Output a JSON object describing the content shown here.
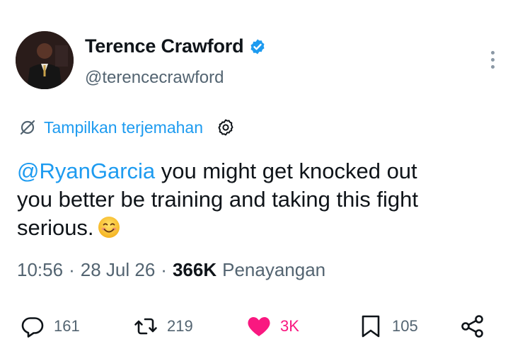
{
  "author": {
    "display_name": "Terence Crawford",
    "handle": "@terencecrawford",
    "verified": true,
    "verified_color": "#1d9bf0"
  },
  "translate": {
    "label": "Tampilkan terjemahan",
    "icon": "no-translate-icon",
    "settings_icon": "gear-icon"
  },
  "tweet": {
    "mention": "@RyanGarcia",
    "text_line1": " you might get knocked out",
    "text_line2": "you better be training and taking this fight",
    "text_line3": "serious.",
    "emoji": "smiling-face-emoji"
  },
  "meta": {
    "time": "10:56",
    "date": "28 Jul 26",
    "views_count": "366K",
    "views_label": "Penayangan",
    "separator": "·"
  },
  "actions": {
    "replies": "161",
    "reposts": "219",
    "likes": "3K",
    "bookmarks": "105"
  },
  "colors": {
    "accent": "#1d9bf0",
    "like": "#f91880",
    "secondary_text": "#536471"
  }
}
